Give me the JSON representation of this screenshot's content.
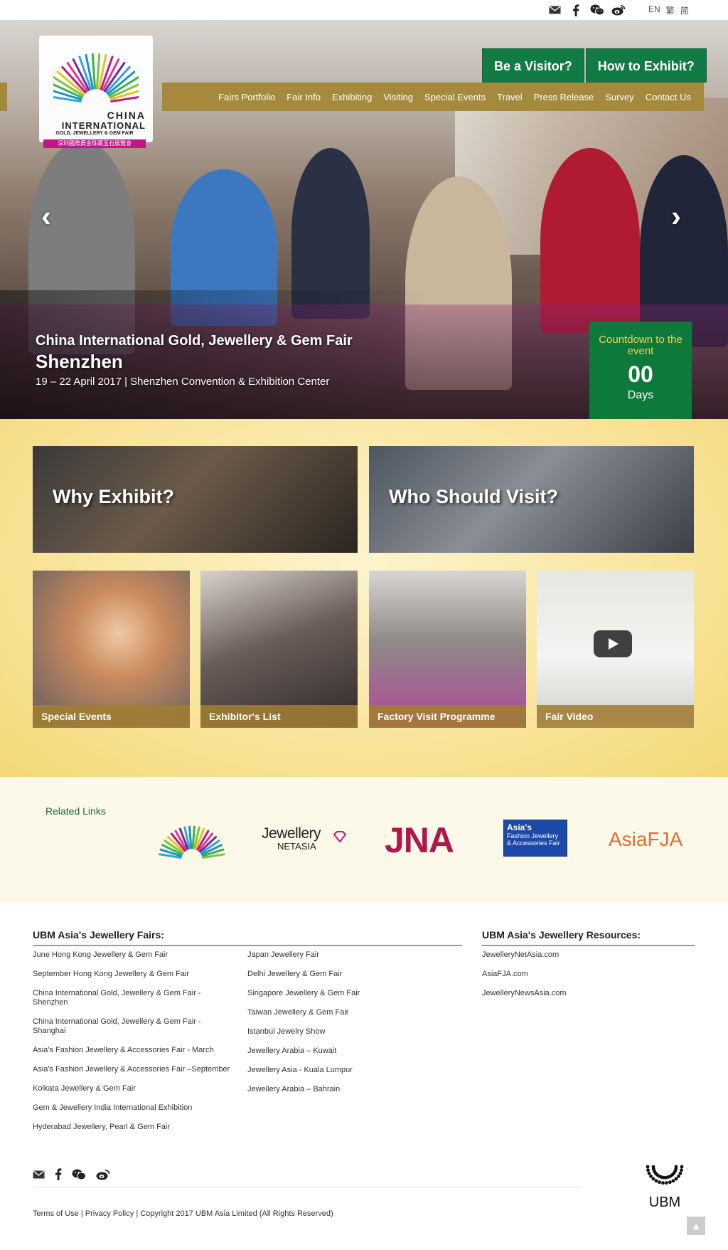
{
  "topbar": {
    "icons": [
      "mail-icon",
      "facebook-icon",
      "wechat-icon",
      "weibo-icon"
    ],
    "languages": [
      "EN",
      "繁",
      "简"
    ]
  },
  "logo": {
    "line1": "CHINA",
    "line2": "INTERNATIONAL",
    "line3": "GOLD, JEWELLERY & GEM FAIR",
    "line4": "深圳國際黃金珠寶玉石展覽會"
  },
  "cta": {
    "visitor": "Be a Visitor?",
    "exhibit": "How to Exhibit?"
  },
  "nav": {
    "items": [
      "Fairs Portfolio",
      "Fair Info",
      "Exhibiting",
      "Visiting",
      "Special Events",
      "Travel",
      "Press Release",
      "Survey",
      "Contact Us"
    ]
  },
  "hero": {
    "prev": "‹",
    "next": "›",
    "title": "China International Gold, Jewellery & Gem Fair",
    "city": "Shenzhen",
    "dates": "19 – 22 April 2017 | Shenzhen Convention & Exhibition Center",
    "countdown": {
      "label": "Countdown to the event",
      "number": "00",
      "unit": "Days"
    }
  },
  "features": {
    "big": [
      "Why Exhibit?",
      "Who Should Visit?"
    ],
    "small": [
      "Special Events",
      "Exhibitor's List",
      "Factory Visit Programme",
      "Fair Video"
    ]
  },
  "related": {
    "heading": "Related Links",
    "logos": {
      "jna": "JNA",
      "netasia_top": "Jewellery",
      "netasia_bottom": "NETASIA",
      "asias_top": "Asia's",
      "asias_mid": "Fashion Jewellery",
      "asias_bot": "& Accessories Fair",
      "asiafja": "AsiaFJA"
    }
  },
  "footer": {
    "fairs_heading": "UBM Asia's Jewellery Fairs:",
    "fairs_col1": [
      "June Hong Kong Jewellery & Gem Fair",
      "September Hong Kong Jewellery & Gem Fair",
      "China International Gold, Jewellery & Gem Fair - Shenzhen",
      "China International Gold, Jewellery & Gem Fair - Shanghai",
      "Asia's Fashion Jewellery & Accessories Fair - March",
      "Asia's Fashion Jewellery & Accessories Fair –September",
      "Kolkata Jewellery & Gem Fair",
      "Gem & Jewellery India International Exhibition",
      "Hyderabad Jewellery, Pearl & Gem Fair"
    ],
    "fairs_col2": [
      "Japan Jewellery Fair",
      "Delhi Jewellery & Gem Fair",
      "Singapore Jewellery & Gem Fair",
      "Taiwan Jewellery & Gem Fair",
      "Istanbul Jewelry Show",
      "Jewellery Arabia – Kuwait",
      "Jewellery Asia - Kuala Lumpur",
      "Jewellery Arabia – Bahrain"
    ],
    "resources_heading": "UBM Asia's Jewellery Resources:",
    "resources": [
      "JewelleryNetAsia.com",
      "AsiaFJA.com",
      "JewelleryNewsAsia.com"
    ],
    "terms": "Terms of Use",
    "privacy": "Privacy Policy",
    "copyright": "Copyright 2017 UBM Asia Limited (All Rights Reserved)",
    "ubm": "UBM",
    "totop": "▲"
  },
  "colors": {
    "nav_gold": "#a58a3e",
    "cta_green": "#127a45",
    "countdown_green": "#0d7a3c",
    "related_heading": "#1d6b3a"
  }
}
